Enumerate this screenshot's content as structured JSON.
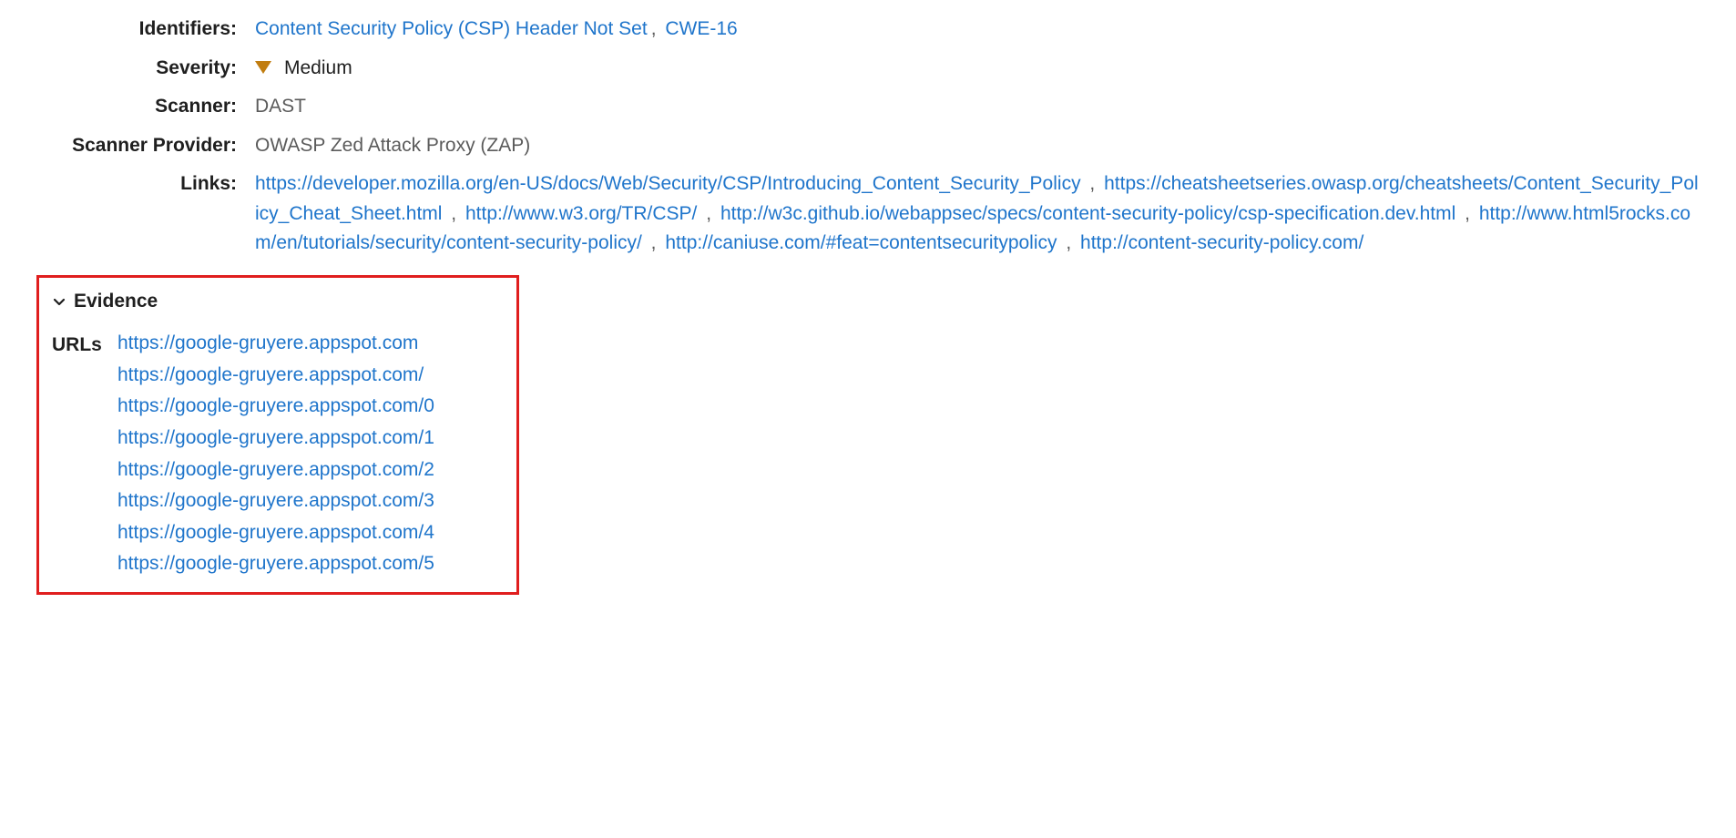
{
  "labels": {
    "identifiers": "Identifiers:",
    "severity": "Severity:",
    "scanner": "Scanner:",
    "scanner_provider": "Scanner Provider:",
    "links": "Links:"
  },
  "identifiers": [
    {
      "text": "Content Security Policy (CSP) Header Not Set"
    },
    {
      "text": "CWE-16"
    }
  ],
  "severity": {
    "level": "Medium",
    "color": "#c17d10"
  },
  "scanner": "DAST",
  "scanner_provider": "OWASP Zed Attack Proxy (ZAP)",
  "links": [
    {
      "text": "https://developer.mozilla.org/en-US/docs/Web/Security/CSP/Introducing_Content_Security_Policy"
    },
    {
      "text": "https://cheatsheetseries.owasp.org/cheatsheets/Content_Security_Policy_Cheat_Sheet.html"
    },
    {
      "text": "http://www.w3.org/TR/CSP/"
    },
    {
      "text": "http://w3c.github.io/webappsec/specs/content-security-policy/csp-specification.dev.html"
    },
    {
      "text": "http://www.html5rocks.com/en/tutorials/security/content-security-policy/"
    },
    {
      "text": "http://caniuse.com/#feat=contentsecuritypolicy"
    },
    {
      "text": "http://content-security-policy.com/"
    }
  ],
  "evidence": {
    "title": "Evidence",
    "urls_label": "URLs",
    "urls": [
      "https://google-gruyere.appspot.com",
      "https://google-gruyere.appspot.com/",
      "https://google-gruyere.appspot.com/0",
      "https://google-gruyere.appspot.com/1",
      "https://google-gruyere.appspot.com/2",
      "https://google-gruyere.appspot.com/3",
      "https://google-gruyere.appspot.com/4",
      "https://google-gruyere.appspot.com/5"
    ]
  }
}
